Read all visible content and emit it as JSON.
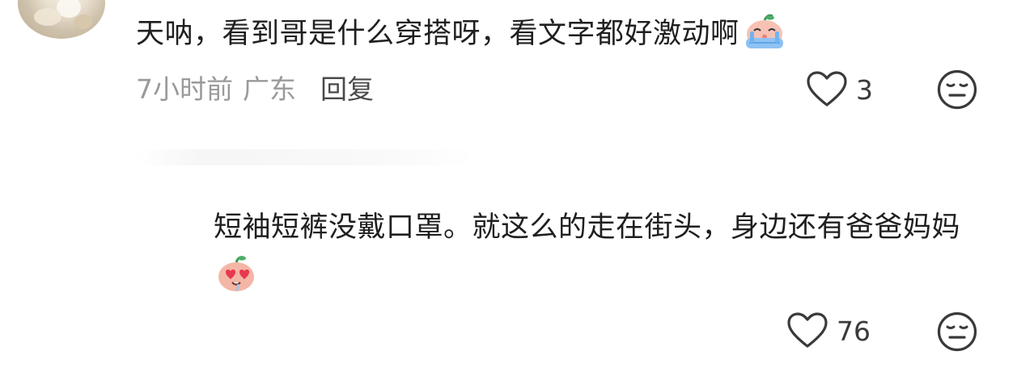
{
  "comments": [
    {
      "text": "天呐，看到哥是什么穿搭呀，看文字都好激动啊",
      "emoji": "crying-peach-emoji",
      "time": "7小时前",
      "location": "广东",
      "reply_label": "回复",
      "likes": "3"
    },
    {
      "text": "短袖短裤没戴口罩。就这么的走在街头，身边还有爸爸妈妈",
      "emoji": "heart-eyes-peach-emoji",
      "likes": "76"
    }
  ],
  "icons": {
    "like": "heart-outline-icon",
    "dislike": "meh-face-icon"
  },
  "colors": {
    "text": "#1f1f1f",
    "meta": "#9a9a9a",
    "reply": "#4a4a4a",
    "icon": "#3a3a3a"
  }
}
